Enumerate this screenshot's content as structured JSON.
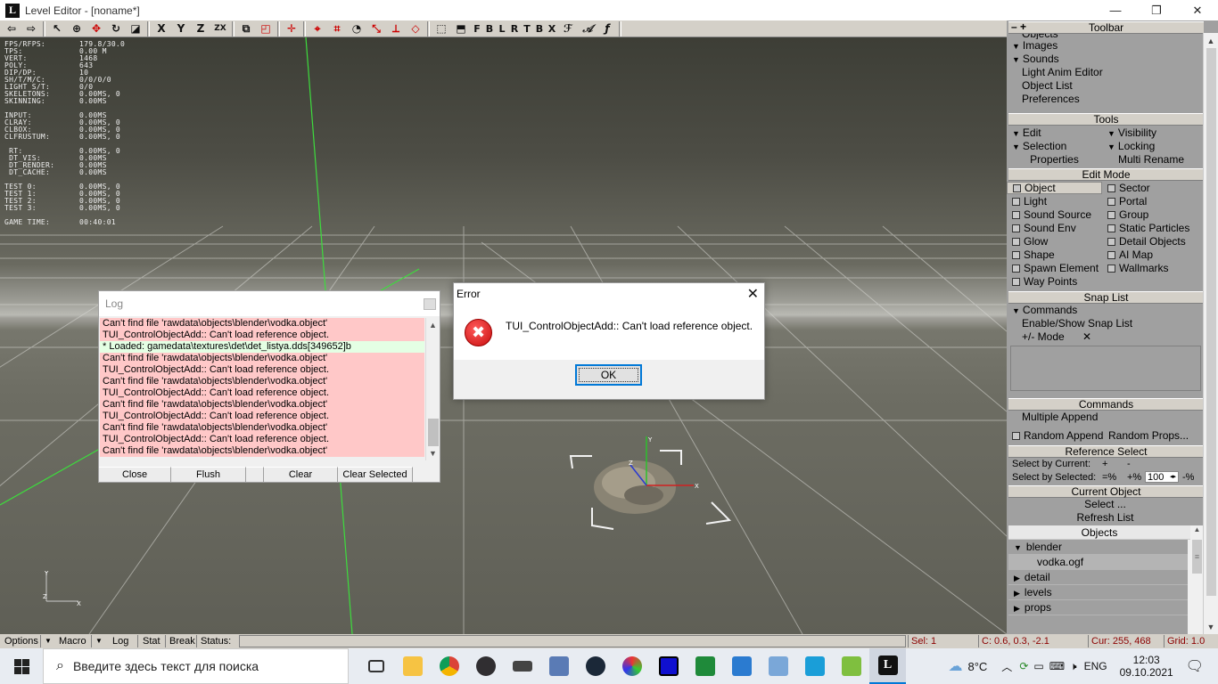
{
  "window": {
    "title": "Level Editor - [noname*]",
    "logo": "L",
    "minimize": "—",
    "restore": "❐",
    "close": "✕"
  },
  "toolbar": {
    "axis_labels": [
      "X",
      "Y",
      "Z",
      "ZX"
    ],
    "view_letters": [
      "F",
      "B",
      "L",
      "R",
      "T",
      "B",
      "X"
    ]
  },
  "stats": [
    [
      "FPS/RFPS:",
      "179.8/30.0"
    ],
    [
      "TPS:",
      "0.00 M"
    ],
    [
      "VERT:",
      "1468"
    ],
    [
      "POLY:",
      "643"
    ],
    [
      "DIP/DP:",
      "10"
    ],
    [
      "SH/T/M/C:",
      "0/0/0/0"
    ],
    [
      "LIGHT S/T:",
      "0/0"
    ],
    [
      "SKELETONS:",
      "0.00MS, 0"
    ],
    [
      "SKINNING:",
      "0.00MS"
    ],
    null,
    [
      "INPUT:",
      "0.00MS"
    ],
    [
      "CLRAY:",
      "0.00MS, 0"
    ],
    [
      "CLBOX:",
      "0.00MS, 0"
    ],
    [
      "CLFRUSTUM:",
      "0.00MS, 0"
    ],
    null,
    [
      " RT:",
      "0.00MS, 0"
    ],
    [
      " DT_VIS:",
      "0.00MS"
    ],
    [
      " DT_RENDER:",
      "0.00MS"
    ],
    [
      " DT_CACHE:",
      "0.00MS"
    ],
    null,
    [
      "TEST 0:",
      "0.00MS, 0"
    ],
    [
      "TEST 1:",
      "0.00MS, 0"
    ],
    [
      "TEST 2:",
      "0.00MS, 0"
    ],
    [
      "TEST 3:",
      "0.00MS, 0"
    ],
    null,
    [
      "GAME TIME:",
      "00:40:01"
    ]
  ],
  "log": {
    "title": "Log",
    "entries": [
      {
        "text": "Can't find file 'rawdata\\objects\\blender\\vodka.object'",
        "kind": "err"
      },
      {
        "text": "TUI_ControlObjectAdd:: Can't load reference object.",
        "kind": "err"
      },
      {
        "text": "* Loaded: gamedata\\textures\\det\\det_listya.dds[349652]b",
        "kind": "ok"
      },
      {
        "text": "Can't find file 'rawdata\\objects\\blender\\vodka.object'",
        "kind": "err"
      },
      {
        "text": "TUI_ControlObjectAdd:: Can't load reference object.",
        "kind": "err"
      },
      {
        "text": "Can't find file 'rawdata\\objects\\blender\\vodka.object'",
        "kind": "err"
      },
      {
        "text": "TUI_ControlObjectAdd:: Can't load reference object.",
        "kind": "err"
      },
      {
        "text": "Can't find file 'rawdata\\objects\\blender\\vodka.object'",
        "kind": "err"
      },
      {
        "text": "TUI_ControlObjectAdd:: Can't load reference object.",
        "kind": "err"
      },
      {
        "text": "Can't find file 'rawdata\\objects\\blender\\vodka.object'",
        "kind": "err"
      },
      {
        "text": "TUI_ControlObjectAdd:: Can't load reference object.",
        "kind": "err"
      },
      {
        "text": "Can't find file 'rawdata\\objects\\blender\\vodka.object'",
        "kind": "err"
      }
    ],
    "buttons": [
      "Close",
      "Flush",
      "Clear",
      "Clear Selected"
    ]
  },
  "error_dialog": {
    "title": "Error",
    "message": "TUI_ControlObjectAdd:: Can't load reference object.",
    "ok": "OK"
  },
  "panel": {
    "toolbar_header": "Toolbar",
    "toolbar_items": [
      "Objects",
      "Images",
      "Sounds",
      "Light Anim Editor",
      "Object List",
      "Preferences"
    ],
    "tools_header": "Tools",
    "tools": {
      "edit": "Edit",
      "visibility": "Visibility",
      "selection": "Selection",
      "locking": "Locking",
      "properties": "Properties",
      "multi_rename": "Multi Rename"
    },
    "editmode_header": "Edit Mode",
    "editmode_left": [
      "Object",
      "Light",
      "Sound Source",
      "Sound Env",
      "Glow",
      "Shape",
      "Spawn Element",
      "Way Points"
    ],
    "editmode_right": [
      "Sector",
      "Portal",
      "Group",
      "Static Particles",
      "Detail Objects",
      "AI Map",
      "Wallmarks"
    ],
    "snap_header": "Snap List",
    "snap_commands": "Commands",
    "snap_enable": "Enable/Show Snap List",
    "snap_mode": "+/- Mode",
    "snap_x": "✕",
    "commands_header": "Commands",
    "multiple_append": "Multiple Append",
    "random_append": "Random Append",
    "random_props": "Random Props...",
    "refselect_header": "Reference Select",
    "select_by_current": "Select by Current:",
    "select_by_selected": "Select by Selected:",
    "plus": "+",
    "minus": "-",
    "eq_pct": "=%",
    "plus_pct": "+%",
    "pct_value": "100",
    "minus_pct": "-%",
    "current_object_header": "Current Object",
    "select": "Select ...",
    "refresh_list": "Refresh List",
    "objects_header": "Objects",
    "tree": [
      {
        "label": "blender",
        "expanded": true,
        "children": [
          "vodka.ogf"
        ]
      },
      {
        "label": "detail",
        "expanded": false
      },
      {
        "label": "levels",
        "expanded": false
      },
      {
        "label": "props",
        "expanded": false
      }
    ]
  },
  "statusbar": {
    "options": "Options",
    "macro": "Macro",
    "log": "Log",
    "stat": "Stat",
    "break": "Break",
    "status": "Status:",
    "sel": "Sel: 1",
    "coords": "C: 0.6, 0.3, -2.1",
    "cursor": "Cur: 255, 468",
    "grid": "Grid: 1.0"
  },
  "taskbar": {
    "search_placeholder": "Введите здесь текст для поиска",
    "temperature": "8°C",
    "language": "ENG",
    "time": "12:03",
    "date": "09.10.2021"
  }
}
